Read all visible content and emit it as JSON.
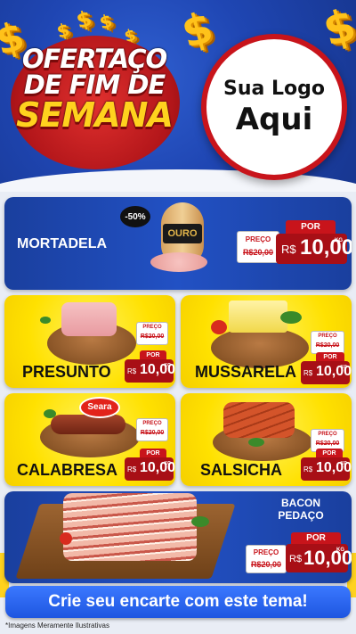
{
  "header": {
    "headline_line1": "OFERTAÇO",
    "headline_line2": "DE FIM DE",
    "headline_line3": "SEMANA",
    "logo_line1": "Sua Logo",
    "logo_line2": "Aqui"
  },
  "products": {
    "mortadela": {
      "name": "MORTADELA",
      "discount": "-50%",
      "brand": "OURO",
      "preco_label": "PREÇO",
      "old_price": "R$20,00",
      "por_label": "POR",
      "currency": "R$",
      "price": "10,00",
      "unit": "KG"
    },
    "presunto": {
      "name": "PRESUNTO",
      "preco_label": "PREÇO",
      "old_price": "R$20,00",
      "por_label": "POR",
      "currency": "R$",
      "price": "10,00",
      "unit": "KG"
    },
    "mussarela": {
      "name": "MUSSARELA",
      "preco_label": "PREÇO",
      "old_price": "R$20,00",
      "por_label": "POR",
      "currency": "R$",
      "price": "10,00",
      "unit": "KG"
    },
    "calabresa": {
      "name": "CALABRESA",
      "brand": "Seara",
      "preco_label": "PREÇO",
      "old_price": "R$20,00",
      "por_label": "POR",
      "currency": "R$",
      "price": "10,00",
      "unit": "KG"
    },
    "salsicha": {
      "name": "SALSICHA",
      "preco_label": "PREÇO",
      "old_price": "R$20,00",
      "por_label": "POR",
      "currency": "R$",
      "price": "10,00",
      "unit": "KG"
    },
    "bacon": {
      "name_line1": "BACON",
      "name_line2": "PEDAÇO",
      "preco_label": "PREÇO",
      "old_price": "R$20,00",
      "por_label": "POR",
      "currency": "R$",
      "price": "10,00",
      "unit": "KG"
    }
  },
  "footer": {
    "cta": "Crie seu encarte com este tema!",
    "note": "*Imagens Meramente Ilustrativas"
  },
  "colors": {
    "blue": "#1f46b3",
    "yellow": "#ffe100",
    "red": "#c8141b",
    "gold": "#ffc21a"
  },
  "icons": [
    "dollar-icon",
    "leaf-icon"
  ]
}
